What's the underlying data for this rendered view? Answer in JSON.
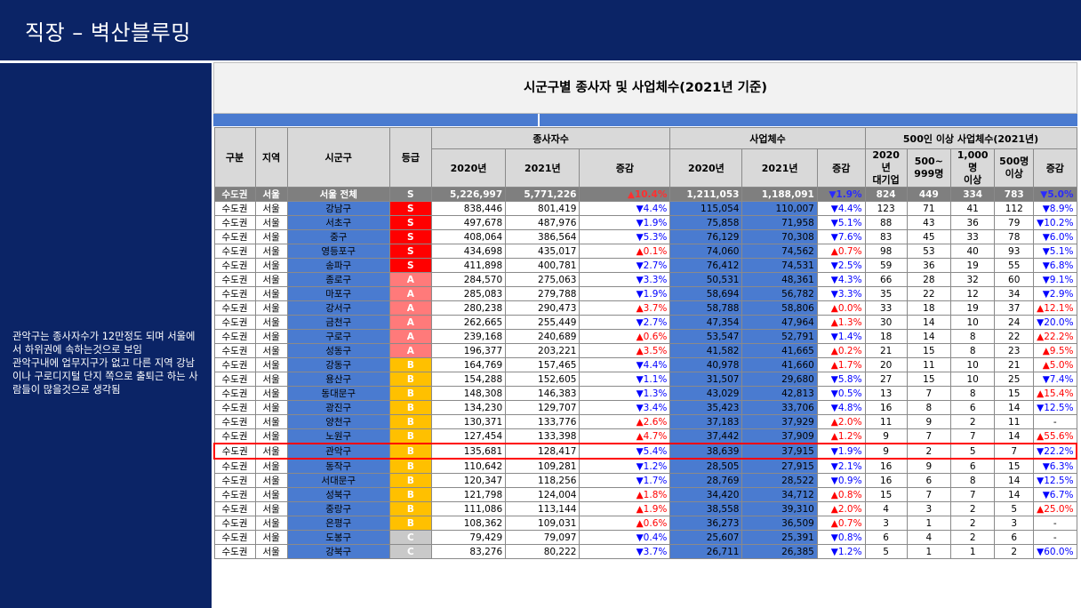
{
  "page_title": "직장 – 벽산블루밍",
  "side_note": "관악구는 종사자수가 12만정도 되며 서울에서 하위권에 속하는것으로 보임\n관악구내에 업무지구가 없고 다른 지역 강남이나 구로디지털 단지 쪽으로 출퇴근 하는 사람들이 많을것으로 생각됨",
  "table_title": "시군구별 종사자 및 사업체수(2021년 기준)",
  "headers": {
    "gubun": "구분",
    "region": "지역",
    "sigungu": "시군구",
    "grade": "등급",
    "workers": "종사자수",
    "biz": "사업체수",
    "big": "500인 이상 사업체수(2021년)",
    "y2020": "2020년",
    "y2021": "2021년",
    "change": "증감",
    "big2020": "2020년\n대기업",
    "b500": "500~\n999명",
    "b1000": "1,000명\n이상",
    "b500p": "500명\n이상",
    "bchg": "증감"
  },
  "colors": {
    "header_bg": "#0b2466",
    "blue_cell": "#4a7bd0",
    "grade_S": "#ff0000",
    "grade_A": "#ff7a7a",
    "grade_B": "#ffc000",
    "grade_C": "#c9c9c9",
    "highlight": "#ff0000"
  },
  "rows": [
    {
      "g": "수도권",
      "r": "서울",
      "s": "서울 전체",
      "gr": "S",
      "w20": "5,226,997",
      "w21": "5,771,226",
      "wc": "▲10.4%",
      "b20": "1,211,053",
      "b21": "1,188,091",
      "bc": "▼1.9%",
      "x1": "824",
      "x2": "449",
      "x3": "334",
      "x4": "783",
      "xc": "▼5.0%",
      "total": true
    },
    {
      "g": "수도권",
      "r": "서울",
      "s": "강남구",
      "gr": "S",
      "w20": "838,446",
      "w21": "801,419",
      "wc": "▼4.4%",
      "b20": "115,054",
      "b21": "110,007",
      "bc": "▼4.4%",
      "x1": "123",
      "x2": "71",
      "x3": "41",
      "x4": "112",
      "xc": "▼8.9%"
    },
    {
      "g": "수도권",
      "r": "서울",
      "s": "서초구",
      "gr": "S",
      "w20": "497,678",
      "w21": "487,976",
      "wc": "▼1.9%",
      "b20": "75,858",
      "b21": "71,958",
      "bc": "▼5.1%",
      "x1": "88",
      "x2": "43",
      "x3": "36",
      "x4": "79",
      "xc": "▼10.2%"
    },
    {
      "g": "수도권",
      "r": "서울",
      "s": "중구",
      "gr": "S",
      "w20": "408,064",
      "w21": "386,564",
      "wc": "▼5.3%",
      "b20": "76,129",
      "b21": "70,308",
      "bc": "▼7.6%",
      "x1": "83",
      "x2": "45",
      "x3": "33",
      "x4": "78",
      "xc": "▼6.0%"
    },
    {
      "g": "수도권",
      "r": "서울",
      "s": "영등포구",
      "gr": "S",
      "w20": "434,698",
      "w21": "435,017",
      "wc": "▲0.1%",
      "b20": "74,060",
      "b21": "74,562",
      "bc": "▲0.7%",
      "x1": "98",
      "x2": "53",
      "x3": "40",
      "x4": "93",
      "xc": "▼5.1%"
    },
    {
      "g": "수도권",
      "r": "서울",
      "s": "송파구",
      "gr": "S",
      "w20": "411,898",
      "w21": "400,781",
      "wc": "▼2.7%",
      "b20": "76,412",
      "b21": "74,531",
      "bc": "▼2.5%",
      "x1": "59",
      "x2": "36",
      "x3": "19",
      "x4": "55",
      "xc": "▼6.8%"
    },
    {
      "g": "수도권",
      "r": "서울",
      "s": "종로구",
      "gr": "A",
      "w20": "284,570",
      "w21": "275,063",
      "wc": "▼3.3%",
      "b20": "50,531",
      "b21": "48,361",
      "bc": "▼4.3%",
      "x1": "66",
      "x2": "28",
      "x3": "32",
      "x4": "60",
      "xc": "▼9.1%"
    },
    {
      "g": "수도권",
      "r": "서울",
      "s": "마포구",
      "gr": "A",
      "w20": "285,083",
      "w21": "279,788",
      "wc": "▼1.9%",
      "b20": "58,694",
      "b21": "56,782",
      "bc": "▼3.3%",
      "x1": "35",
      "x2": "22",
      "x3": "12",
      "x4": "34",
      "xc": "▼2.9%"
    },
    {
      "g": "수도권",
      "r": "서울",
      "s": "강서구",
      "gr": "A",
      "w20": "280,238",
      "w21": "290,473",
      "wc": "▲3.7%",
      "b20": "58,788",
      "b21": "58,806",
      "bc": "▲0.0%",
      "x1": "33",
      "x2": "18",
      "x3": "19",
      "x4": "37",
      "xc": "▲12.1%"
    },
    {
      "g": "수도권",
      "r": "서울",
      "s": "금천구",
      "gr": "A",
      "w20": "262,665",
      "w21": "255,449",
      "wc": "▼2.7%",
      "b20": "47,354",
      "b21": "47,964",
      "bc": "▲1.3%",
      "x1": "30",
      "x2": "14",
      "x3": "10",
      "x4": "24",
      "xc": "▼20.0%"
    },
    {
      "g": "수도권",
      "r": "서울",
      "s": "구로구",
      "gr": "A",
      "w20": "239,168",
      "w21": "240,689",
      "wc": "▲0.6%",
      "b20": "53,547",
      "b21": "52,791",
      "bc": "▼1.4%",
      "x1": "18",
      "x2": "14",
      "x3": "8",
      "x4": "22",
      "xc": "▲22.2%"
    },
    {
      "g": "수도권",
      "r": "서울",
      "s": "성동구",
      "gr": "A",
      "w20": "196,377",
      "w21": "203,221",
      "wc": "▲3.5%",
      "b20": "41,582",
      "b21": "41,665",
      "bc": "▲0.2%",
      "x1": "21",
      "x2": "15",
      "x3": "8",
      "x4": "23",
      "xc": "▲9.5%"
    },
    {
      "g": "수도권",
      "r": "서울",
      "s": "강동구",
      "gr": "B",
      "w20": "164,769",
      "w21": "157,465",
      "wc": "▼4.4%",
      "b20": "40,978",
      "b21": "41,660",
      "bc": "▲1.7%",
      "x1": "20",
      "x2": "11",
      "x3": "10",
      "x4": "21",
      "xc": "▲5.0%"
    },
    {
      "g": "수도권",
      "r": "서울",
      "s": "용산구",
      "gr": "B",
      "w20": "154,288",
      "w21": "152,605",
      "wc": "▼1.1%",
      "b20": "31,507",
      "b21": "29,680",
      "bc": "▼5.8%",
      "x1": "27",
      "x2": "15",
      "x3": "10",
      "x4": "25",
      "xc": "▼7.4%"
    },
    {
      "g": "수도권",
      "r": "서울",
      "s": "동대문구",
      "gr": "B",
      "w20": "148,308",
      "w21": "146,383",
      "wc": "▼1.3%",
      "b20": "43,029",
      "b21": "42,813",
      "bc": "▼0.5%",
      "x1": "13",
      "x2": "7",
      "x3": "8",
      "x4": "15",
      "xc": "▲15.4%"
    },
    {
      "g": "수도권",
      "r": "서울",
      "s": "광진구",
      "gr": "B",
      "w20": "134,230",
      "w21": "129,707",
      "wc": "▼3.4%",
      "b20": "35,423",
      "b21": "33,706",
      "bc": "▼4.8%",
      "x1": "16",
      "x2": "8",
      "x3": "6",
      "x4": "14",
      "xc": "▼12.5%"
    },
    {
      "g": "수도권",
      "r": "서울",
      "s": "양천구",
      "gr": "B",
      "w20": "130,371",
      "w21": "133,776",
      "wc": "▲2.6%",
      "b20": "37,183",
      "b21": "37,929",
      "bc": "▲2.0%",
      "x1": "11",
      "x2": "9",
      "x3": "2",
      "x4": "11",
      "xc": "-"
    },
    {
      "g": "수도권",
      "r": "서울",
      "s": "노원구",
      "gr": "B",
      "w20": "127,454",
      "w21": "133,398",
      "wc": "▲4.7%",
      "b20": "37,442",
      "b21": "37,909",
      "bc": "▲1.2%",
      "x1": "9",
      "x2": "7",
      "x3": "7",
      "x4": "14",
      "xc": "▲55.6%"
    },
    {
      "g": "수도권",
      "r": "서울",
      "s": "관악구",
      "gr": "B",
      "w20": "135,681",
      "w21": "128,417",
      "wc": "▼5.4%",
      "b20": "38,639",
      "b21": "37,915",
      "bc": "▼1.9%",
      "x1": "9",
      "x2": "2",
      "x3": "5",
      "x4": "7",
      "xc": "▼22.2%",
      "hl": true
    },
    {
      "g": "수도권",
      "r": "서울",
      "s": "동작구",
      "gr": "B",
      "w20": "110,642",
      "w21": "109,281",
      "wc": "▼1.2%",
      "b20": "28,505",
      "b21": "27,915",
      "bc": "▼2.1%",
      "x1": "16",
      "x2": "9",
      "x3": "6",
      "x4": "15",
      "xc": "▼6.3%"
    },
    {
      "g": "수도권",
      "r": "서울",
      "s": "서대문구",
      "gr": "B",
      "w20": "120,347",
      "w21": "118,256",
      "wc": "▼1.7%",
      "b20": "28,769",
      "b21": "28,522",
      "bc": "▼0.9%",
      "x1": "16",
      "x2": "6",
      "x3": "8",
      "x4": "14",
      "xc": "▼12.5%"
    },
    {
      "g": "수도권",
      "r": "서울",
      "s": "성북구",
      "gr": "B",
      "w20": "121,798",
      "w21": "124,004",
      "wc": "▲1.8%",
      "b20": "34,420",
      "b21": "34,712",
      "bc": "▲0.8%",
      "x1": "15",
      "x2": "7",
      "x3": "7",
      "x4": "14",
      "xc": "▼6.7%"
    },
    {
      "g": "수도권",
      "r": "서울",
      "s": "중랑구",
      "gr": "B",
      "w20": "111,086",
      "w21": "113,144",
      "wc": "▲1.9%",
      "b20": "38,558",
      "b21": "39,310",
      "bc": "▲2.0%",
      "x1": "4",
      "x2": "3",
      "x3": "2",
      "x4": "5",
      "xc": "▲25.0%"
    },
    {
      "g": "수도권",
      "r": "서울",
      "s": "은평구",
      "gr": "B",
      "w20": "108,362",
      "w21": "109,031",
      "wc": "▲0.6%",
      "b20": "36,273",
      "b21": "36,509",
      "bc": "▲0.7%",
      "x1": "3",
      "x2": "1",
      "x3": "2",
      "x4": "3",
      "xc": "-"
    },
    {
      "g": "수도권",
      "r": "서울",
      "s": "도봉구",
      "gr": "C",
      "w20": "79,429",
      "w21": "79,097",
      "wc": "▼0.4%",
      "b20": "25,607",
      "b21": "25,391",
      "bc": "▼0.8%",
      "x1": "6",
      "x2": "4",
      "x3": "2",
      "x4": "6",
      "xc": "-"
    },
    {
      "g": "수도권",
      "r": "서울",
      "s": "강북구",
      "gr": "C",
      "w20": "83,276",
      "w21": "80,222",
      "wc": "▼3.7%",
      "b20": "26,711",
      "b21": "26,385",
      "bc": "▼1.2%",
      "x1": "5",
      "x2": "1",
      "x3": "1",
      "x4": "2",
      "xc": "▼60.0%"
    }
  ]
}
